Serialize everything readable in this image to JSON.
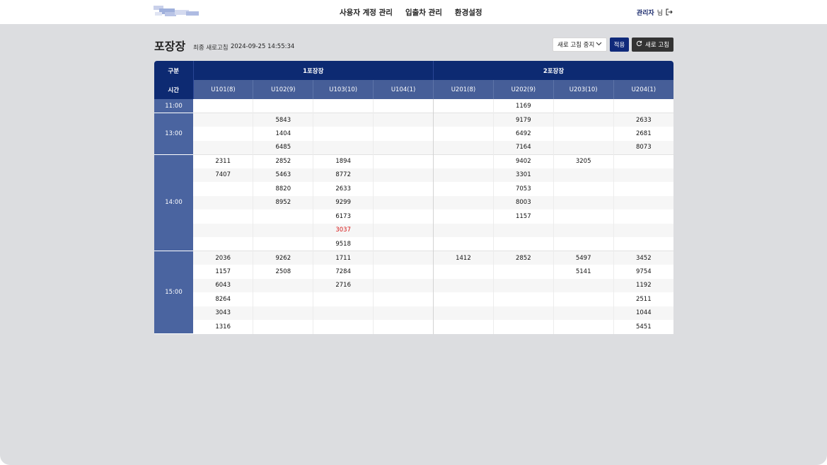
{
  "header": {
    "nav": [
      "사용자 계정 관리",
      "입출차 관리",
      "환경설정"
    ],
    "user_name": "관리자",
    "user_suffix": "님"
  },
  "page": {
    "title": "포장장",
    "last_refresh_label": "최종 새로고침",
    "last_refresh_time": "2024-09-25 14:55:34",
    "select_value": "새로 고침 중지",
    "apply_label": "적용",
    "refresh_label": "새로 고침"
  },
  "table": {
    "corner_top": "구분",
    "corner_bottom": "시간",
    "groups": [
      "1포장장",
      "2포장장"
    ],
    "columns": [
      "U101(8)",
      "U102(9)",
      "U103(10)",
      "U104(1)",
      "U201(8)",
      "U202(9)",
      "U203(10)",
      "U204(1)"
    ],
    "time_groups": [
      {
        "time": "11:00",
        "rows": [
          [
            "",
            "",
            "",
            "",
            "",
            "1169",
            "",
            ""
          ]
        ]
      },
      {
        "time": "13:00",
        "rows": [
          [
            "",
            "5843",
            "",
            "",
            "",
            "9179",
            "",
            "2633"
          ],
          [
            "",
            "1404",
            "",
            "",
            "",
            "6492",
            "",
            "2681"
          ],
          [
            "",
            "6485",
            "",
            "",
            "",
            "7164",
            "",
            "8073"
          ]
        ]
      },
      {
        "time": "14:00",
        "rows": [
          [
            "2311",
            "2852",
            "1894",
            "",
            "",
            "9402",
            "3205",
            ""
          ],
          [
            "7407",
            "5463",
            "8772",
            "",
            "",
            "3301",
            "",
            ""
          ],
          [
            "",
            "8820",
            "2633",
            "",
            "",
            "7053",
            "",
            ""
          ],
          [
            "",
            "8952",
            "9299",
            "",
            "",
            "8003",
            "",
            ""
          ],
          [
            "",
            "",
            "6173",
            "",
            "",
            "1157",
            "",
            ""
          ],
          [
            "",
            "",
            "3037",
            "",
            "",
            "",
            "",
            ""
          ],
          [
            "",
            "",
            "9518",
            "",
            "",
            "",
            "",
            ""
          ]
        ]
      },
      {
        "time": "15:00",
        "rows": [
          [
            "2036",
            "9262",
            "1711",
            "",
            "1412",
            "2852",
            "5497",
            "3452"
          ],
          [
            "1157",
            "2508",
            "7284",
            "",
            "",
            "",
            "5141",
            "9754"
          ],
          [
            "6043",
            "",
            "2716",
            "",
            "",
            "",
            "",
            "1192"
          ],
          [
            "8264",
            "",
            "",
            "",
            "",
            "",
            "",
            "2511"
          ],
          [
            "3043",
            "",
            "",
            "",
            "",
            "",
            "",
            "1044"
          ],
          [
            "1316",
            "",
            "",
            "",
            "",
            "",
            "",
            "5451"
          ]
        ]
      }
    ],
    "highlight": {
      "group": 2,
      "row": 5,
      "col": 2,
      "color": "#d61515"
    }
  },
  "colors": {
    "header_dark": "#0d2a72",
    "header_mid": "#465e98",
    "accent": "#102a7a",
    "background": "#dcdde0"
  },
  "icons": [
    "logout-icon",
    "chevron-down-icon",
    "refresh-icon"
  ]
}
